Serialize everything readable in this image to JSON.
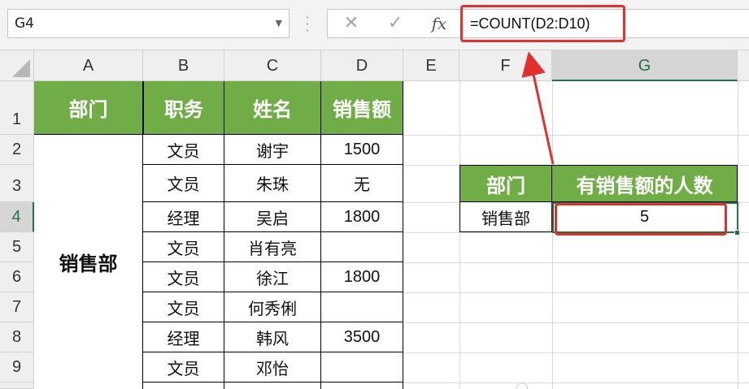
{
  "formula_bar": {
    "name_box": "G4",
    "cancel_icon": "✕",
    "enter_icon": "✓",
    "fx_label": "fx",
    "formula": "=COUNT(D2:D10)"
  },
  "columns": [
    "A",
    "B",
    "C",
    "D",
    "E",
    "F",
    "G"
  ],
  "rows": [
    "1",
    "2",
    "3",
    "4",
    "5",
    "6",
    "7",
    "8",
    "9"
  ],
  "table": {
    "headers": [
      "部门",
      "职务",
      "姓名",
      "销售额"
    ],
    "department": "销售部",
    "records": [
      {
        "role": "文员",
        "name": "谢宇",
        "sales": "1500"
      },
      {
        "role": "文员",
        "name": "朱珠",
        "sales": "无"
      },
      {
        "role": "经理",
        "name": "吴启",
        "sales": "1800"
      },
      {
        "role": "文员",
        "name": "肖有亮",
        "sales": ""
      },
      {
        "role": "文员",
        "name": "徐江",
        "sales": "1800"
      },
      {
        "role": "文员",
        "name": "何秀俐",
        "sales": ""
      },
      {
        "role": "经理",
        "name": "韩风",
        "sales": "3500"
      },
      {
        "role": "文员",
        "name": "邓怡",
        "sales": ""
      }
    ]
  },
  "summary": {
    "header_dept": "部门",
    "header_count": "有销售额的人数",
    "dept": "销售部",
    "count": "5"
  },
  "colors": {
    "header_green": "#70ad47",
    "highlight_red": "#e03030",
    "excel_green": "#217346"
  }
}
